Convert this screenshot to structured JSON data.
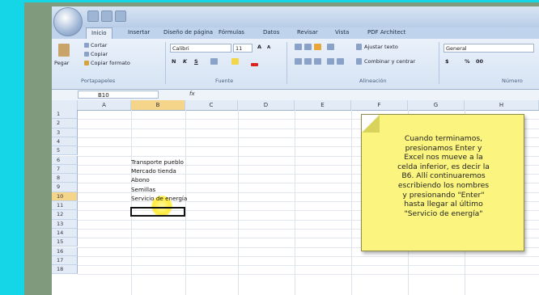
{
  "tabs": [
    "Inicio",
    "Insertar",
    "Diseño de página",
    "Fórmulas",
    "Datos",
    "Revisar",
    "Vista",
    "PDF Architect"
  ],
  "ribbon": {
    "cut": "Cortar",
    "copy": "Copiar",
    "paste": "Pegar",
    "format_painter": "Copiar formato",
    "clipboard_group": "Portapapeles",
    "font_name": "Calibri",
    "font_size": "11",
    "font_group": "Fuente",
    "wrap_text": "Ajustar texto",
    "merge_center": "Combinar y centrar",
    "alignment_group": "Alineación",
    "number_format": "General",
    "number_group": "Número",
    "bold": "N",
    "italic": "K",
    "underline": "S",
    "grow": "A",
    "shrink": "A",
    "currency": "$",
    "percent": "%",
    "thousands": "00"
  },
  "formula_bar": {
    "name_box": "B10",
    "fx": "fx"
  },
  "columns": [
    "A",
    "B",
    "C",
    "D",
    "E",
    "F",
    "G",
    "H"
  ],
  "rows": [
    "1",
    "2",
    "3",
    "4",
    "5",
    "6",
    "7",
    "8",
    "9",
    "10",
    "11",
    "12",
    "13",
    "14",
    "15",
    "16",
    "17",
    "18"
  ],
  "cells": {
    "B5": "Transporte pueblo",
    "B6": "Mercado tienda",
    "B7": "Abono",
    "B8": "Semillas",
    "B9": "Servicio de energía"
  },
  "note": "Cuando terminamos,\npresionamos Enter y\nExcel nos mueve a la\ncelda inferior, es decir la\nB6. Allí continuaremos\nescribiendo los nombres\ny presionando \"Enter\"\nhasta llegar al último\n\"Servicio de energía\""
}
